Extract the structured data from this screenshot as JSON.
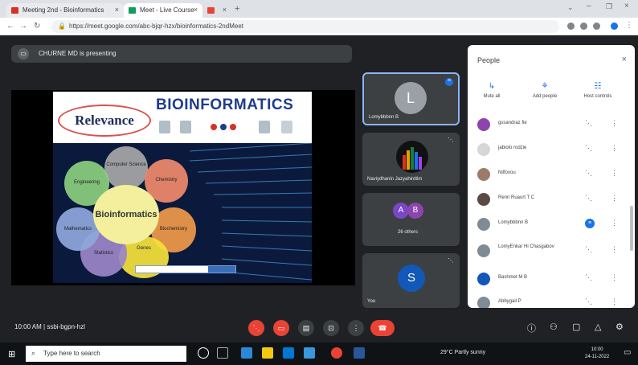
{
  "browser": {
    "tabs": [
      {
        "label": "Meeting 2nd - Bioinformatics",
        "color": "#e8eaed"
      },
      {
        "label": "Meet - Live Course",
        "color": "#ffffff"
      },
      {
        "label": "",
        "color": "#dee1e6"
      }
    ],
    "url": "https://meet.google.com/abc-bjqr-hzx/bioinformatics-2ndMeet"
  },
  "banner": {
    "text": "CHURNE MD is presenting"
  },
  "slide": {
    "relevance": "Relevance",
    "title": "BIOINFORMATICS",
    "center": "Bioinformatics",
    "petals": [
      "Computer Science",
      "Chemistry",
      "Biochemistry",
      "Genes",
      "Statistics",
      "Mathematics",
      "Engineering"
    ]
  },
  "tiles": [
    {
      "name": "Lomybbbnn B",
      "initial": "L",
      "avatar_color": "#9aa0a6"
    },
    {
      "name": "Naviydhanin Jazyahirdtim",
      "initial": "",
      "avatar_color": "#111111"
    },
    {
      "name": "26 others",
      "initial": "A",
      "initial2": "B",
      "avatar_color": "#7b46c7"
    },
    {
      "name": "You",
      "initial": "S",
      "avatar_color": "#1158b8"
    }
  ],
  "people": {
    "title": "People",
    "actions": [
      {
        "icon": "↳",
        "label": "Mute all"
      },
      {
        "icon": "⚘",
        "label": "Add people"
      },
      {
        "icon": "☷",
        "label": "Host controls"
      }
    ],
    "rows": [
      {
        "name": "gssandraz fie",
        "color": "#8e44ad"
      },
      {
        "name": "jabiolo rodzie",
        "color": "#d6d6d6"
      },
      {
        "name": "Nilfoxou",
        "color": "#9b7c6a"
      },
      {
        "name": "Renn Ruaurt T C",
        "color": "#5a4a42"
      },
      {
        "name": "Lomybbbnn B",
        "color": "#7f8c96"
      },
      {
        "name": "LomyEnkar Hi Chasgabov",
        "color": "#7f8c96"
      },
      {
        "name": "Bashmet M B",
        "color": "#1158b8"
      },
      {
        "name": "Abbygail P",
        "color": "#7f8c96"
      }
    ]
  },
  "bottom": {
    "meeting_info": "10:00 AM  |  ssbi-bgpn-hzl"
  },
  "taskbar": {
    "search_placeholder": "Type here to search",
    "tray": "29°C Partly sunny",
    "time": "10:00",
    "date": "24-11-2022"
  }
}
